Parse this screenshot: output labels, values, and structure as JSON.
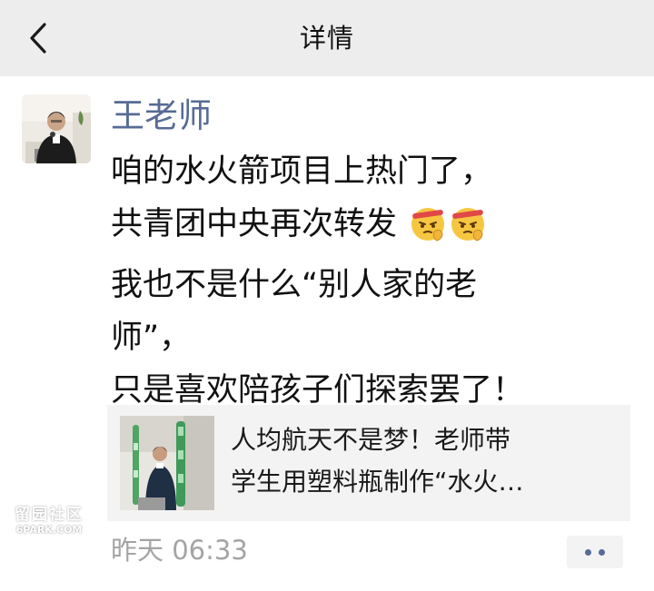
{
  "header": {
    "title": "详情",
    "back_icon": "chevron-left-icon"
  },
  "post": {
    "author": "王老师",
    "lines": [
      "咱的水火箭项目上热门了，",
      "共青团中央再次转发",
      "我也不是什么“别人家的老",
      "师”，",
      "只是喜欢陪孩子们探索罢了！"
    ],
    "emoji": [
      "saluting-face-emoji",
      "saluting-face-emoji"
    ],
    "timestamp": "昨天 06:33"
  },
  "link_card": {
    "title_line1": "人均航天不是梦！老师带",
    "title_line2": "学生用塑料瓶制作“水火…"
  },
  "watermark": {
    "glyphs": "留园社区",
    "domain": "6PARK.COM"
  },
  "colors": {
    "navbar_bg": "#ededed",
    "author_name": "#576b95",
    "card_bg": "#f3f3f3",
    "timestamp": "#a4a4a4"
  }
}
